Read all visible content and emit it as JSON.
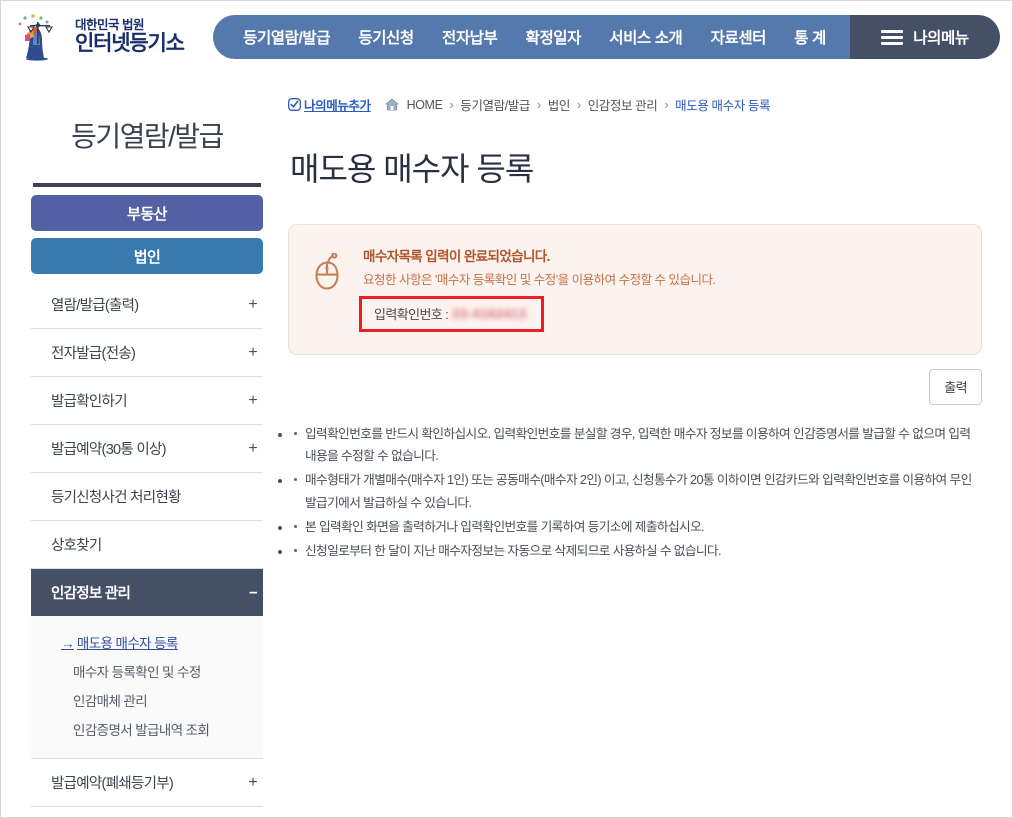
{
  "header": {
    "logo": {
      "icon": "justice-scales-logo",
      "line1": "대한민국 법원",
      "line2": "인터넷등기소"
    },
    "nav_items": [
      {
        "label": "등기열람/발급"
      },
      {
        "label": "등기신청"
      },
      {
        "label": "전자납부"
      },
      {
        "label": "확정일자"
      },
      {
        "label": "서비스 소개"
      },
      {
        "label": "자료센터"
      },
      {
        "label": "통 계"
      }
    ],
    "mymenu": {
      "icon": "hamburger-icon",
      "label": "나의메뉴"
    }
  },
  "breadcrumb": {
    "add_icon": "check-square-icon",
    "add_label": "나의메뉴추가",
    "home_icon": "home-icon",
    "home_label": "HOME",
    "separator": "›",
    "items": [
      {
        "label": "등기열람/발급"
      },
      {
        "label": "법인"
      },
      {
        "label": "인감정보 관리"
      },
      {
        "label": "매도용 매수자 등록"
      }
    ]
  },
  "sidebar": {
    "title": "등기열람/발급",
    "tabs": [
      {
        "label": "부동산",
        "active": false,
        "color": "#5360a4"
      },
      {
        "label": "법인",
        "active": true,
        "color": "#3a79ad"
      }
    ],
    "menu": [
      {
        "label": "열람/발급(출력)",
        "expander": "+"
      },
      {
        "label": "전자발급(전송)",
        "expander": "+"
      },
      {
        "label": "발급확인하기",
        "expander": "+"
      },
      {
        "label": "발급예약(30통 이상)",
        "expander": "+"
      },
      {
        "label": "등기신청사건 처리현황",
        "expander": ""
      },
      {
        "label": "상호찾기",
        "expander": ""
      },
      {
        "label": "인감정보 관리",
        "expander": "−",
        "active": true
      },
      {
        "label": "발급예약(폐쇄등기부)",
        "expander": "+"
      }
    ],
    "submenu": {
      "arrow": "→",
      "items": [
        {
          "label": "매도용 매수자 등록",
          "current": true
        },
        {
          "label": "매수자 등록확인 및 수정",
          "current": false
        },
        {
          "label": "인감매체 관리",
          "current": false
        },
        {
          "label": "인감증명서 발급내역 조회",
          "current": false
        }
      ]
    }
  },
  "main": {
    "page_title": "매도용 매수자 등록",
    "alert": {
      "icon": "mouse-icon",
      "heading": "매수자목록 입력이 완료되었습니다.",
      "subtext": "요청한 사항은 '매수자 등록확인 및 수정'을 이용하여 수정할 수 있습니다.",
      "confirm_label": "입력확인번호 :",
      "confirm_value": "23-4162413",
      "confirm_redacted": true,
      "highlight_color": "#ee1c24"
    },
    "print_button": "출력",
    "notices": [
      "입력확인번호를 반드시 확인하십시오. 입력확인번호를 분실할 경우, 입력한 매수자 정보를 이용하여 인감증명서를 발급할 수 없으며 입력 내용을 수정할 수 없습니다.",
      "매수형태가 개별매수(매수자 1인) 또는 공동매수(매수자 2인) 이고, 신청통수가 20통 이하이면 인감카드와 입력확인번호를 이용하여 무인 발급기에서 발급하실 수 있습니다.",
      "본 입력확인 화면을 출력하거나 입력확인번호를 기록하여 등기소에 제출하십시오.",
      "신청일로부터 한 달이 지난 매수자정보는 자동으로 삭제되므로 사용하실 수 없습니다."
    ]
  }
}
